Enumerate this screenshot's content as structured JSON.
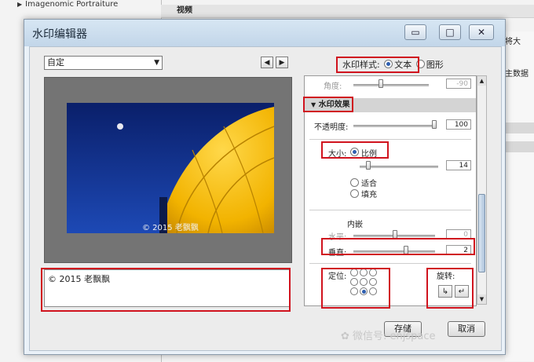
{
  "background": {
    "tree_item": "Imagenomic Portraiture",
    "panel_header": "视频",
    "right_text_1": "将大",
    "right_text_2": "主数据"
  },
  "window": {
    "title": "水印编辑器",
    "minimize_label": "▭",
    "maximize_label": "□",
    "close_label": "✕"
  },
  "left": {
    "preset_value": "自定",
    "prev_label": "◀",
    "next_label": "▶",
    "photo_watermark": "© 2015 老飘飘",
    "text_value": "© 2015 老飘飘"
  },
  "watermark_style": {
    "label": "水印样式:",
    "options": [
      "文本",
      "图形"
    ],
    "selected": "文本"
  },
  "panel": {
    "angle_label": "角度:",
    "angle_value": "-90",
    "section_title": "水印效果",
    "opacity_label": "不透明度:",
    "opacity_value": "100",
    "opacity_level": 1.0,
    "size_label": "大小:",
    "size_options": [
      "比例",
      "适合",
      "填充"
    ],
    "size_value": "14",
    "size_level": 0.08,
    "inset_label": "内嵌",
    "horizontal_label": "水平:",
    "horizontal_value": "0",
    "vertical_label": "垂直:",
    "vertical_value": "2",
    "position_label": "定位:",
    "rotate_label": "旋转:",
    "rotate_left_icon": "↳",
    "rotate_right_icon": "↵"
  },
  "buttons": {
    "save": "存储",
    "cancel": "取消"
  },
  "watermark_credit": "微信号: enjspace",
  "colors": {
    "highlight": "#d0131e",
    "accent": "#2f5fb0"
  }
}
